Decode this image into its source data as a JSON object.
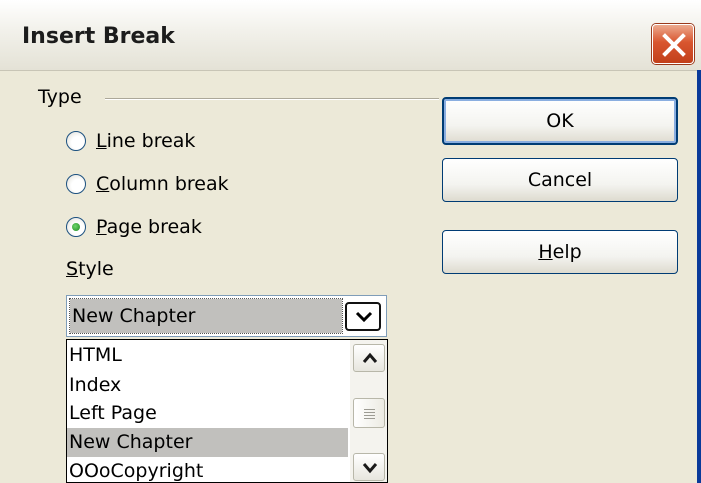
{
  "window": {
    "title": "Insert Break"
  },
  "type_group": {
    "label": "Type",
    "options": [
      {
        "label": "Line break",
        "mnemonic": "L",
        "rest": "ine break",
        "selected": false
      },
      {
        "label": "Column break",
        "mnemonic": "C",
        "rest": "olumn break",
        "selected": false
      },
      {
        "label": "Page break",
        "mnemonic": "P",
        "rest": "age break",
        "selected": true
      }
    ]
  },
  "style": {
    "label": "Style",
    "mnemonic": "S",
    "rest": "tyle",
    "selected_value": "New Chapter",
    "list_items": [
      "HTML",
      "Index",
      "Left Page",
      "New Chapter",
      "OOoCopyright"
    ],
    "selected_index": 3
  },
  "buttons": {
    "ok": {
      "label": "OK"
    },
    "cancel": {
      "label": "Cancel"
    },
    "help": {
      "label": "Help",
      "mnemonic": "H",
      "rest": "elp"
    }
  },
  "icons": {
    "close": "close-icon",
    "dropdown": "chevron-down-icon",
    "scroll_up": "chevron-up-icon",
    "scroll_down": "chevron-down-icon"
  },
  "colors": {
    "close_button": "#d9562f",
    "selection": "#c1c0bd",
    "radio_dot": "#1f8a1f"
  }
}
